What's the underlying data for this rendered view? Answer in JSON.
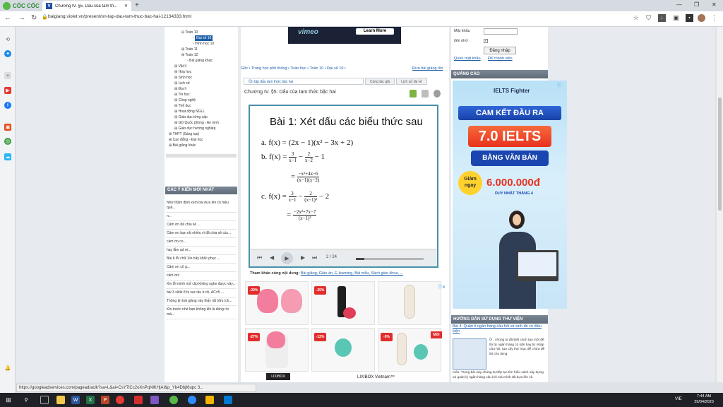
{
  "browser": {
    "brand": "CỐC CỐC",
    "tab_title": "Chương IV. §5. Dấu của tam th...",
    "tab_favicon": "V",
    "url": "baigiang.violet.vn/present/on-tap-dau-tam-thuc-bac-hai-12134333.html"
  },
  "tree": {
    "items": [
      "Toán 10",
      "Đại số 10",
      "Hình học 10",
      "Toán 11",
      "Toán 12",
      "Bài giảng khác",
      "Vật lí",
      "Hóa học",
      "Sinh học",
      "Lịch sử",
      "Địa lí",
      "Tin học",
      "Công nghệ",
      "Thể dục",
      "Hoạt động NGLL",
      "Giáo dục từng cấp",
      "GD Quốc phòng - An ninh",
      "Giáo dục hướng nghiệp",
      "THPT (Sáng tạo)",
      "Cao đẳng - Đại học",
      "Bài giảng khác"
    ]
  },
  "comments": {
    "heading": "CÁC Ý KIẾN MỚI NHẤT",
    "items": [
      "Nhờ thầm định xem bài dưa lên có hiệu quả...",
      "n...",
      "Cảm ơn đã chia sẻ ...",
      "Cảm ơn bạn rất nhiều vì đã chia sẻ các...",
      "cảm ơn co...",
      "hay lắm ạd ơi...",
      "Bài b lỗi chữ Xin hãy khắc phục ...",
      "Cảm ơn cô g...",
      "cảm ơn!",
      "Xin lỗi mình mở clip không nghe được vậy...",
      "bài 3 slide 8 bị sai câu b rồi, AC=5 ...",
      "Thông tin bài giảng này thấy rất hữu ích...",
      "Khi trước nhé bạn không khi là đúng rồi mà..."
    ]
  },
  "ad_top": {
    "brand": "vimeo",
    "button": "Learn More"
  },
  "breadcrumb": "Gốc • Trung học phổ thông • Toán học • Toán 10 • Đại số 10 •",
  "download_link": "Đưa bài giảng lên",
  "tabs": [
    "Ôn tập dấu tam thức bậc hai",
    "Cùng tác giả",
    "Lịch sử tải về"
  ],
  "doc_title": "Chương IV. §5. Dấu của tam thức bậc hai",
  "slide": {
    "title": "Bài 1: Xét dấu các biểu thức sau",
    "a": "a. f(x) = (2x − 1)(x² − 3x + 2)",
    "b_label": "b. f(x) =",
    "c_label": "c. f(x) =",
    "fa_num": "3",
    "fa_den": "x−1",
    "fb_num": "2",
    "fb_den": "x−2",
    "b_tail": "− 1",
    "b_res_num": "−x²+4x−6",
    "b_res_den": "(x−1)(x−2)",
    "fc_num": "3",
    "fc_den": "x−1",
    "fd_num": "2",
    "fd_den": "(x−1)²",
    "c_tail": "− 2",
    "c_res_num": "−2x²+7x−7",
    "c_res_den": "(x−1)²",
    "eq": "=",
    "minus": "−",
    "page": "2 / 24"
  },
  "reference": {
    "label": "Tham khảo cùng nội dung:",
    "links": "Bài giảng, Giáo án, E-learning, Bài mẫu, Sách giáo khoa, ..."
  },
  "products": {
    "discounts": [
      "-29%",
      "-25%",
      "-27%",
      "-12%",
      "-9%"
    ],
    "sale_badge": "Mới",
    "brand1": "LIXIBOX",
    "brand2": "LIXIBOX Vietnam™"
  },
  "login": {
    "password_label": "Mật khẩu",
    "remember_label": "Ghi nhớ",
    "login_button": "Đăng nhập",
    "forgot": "Quên mật khẩu",
    "register": "ĐK thành viên"
  },
  "ads_heading": "QUẢNG CÁO",
  "ielts": {
    "logo": "IELTS Fighter",
    "ribbon": "CAM KẾT ĐẦU RA",
    "big": "7.0 IELTS",
    "bvb": "BẰNG VĂN BẢN",
    "giam": "Giảm ngay",
    "money": "6.000.000đ",
    "duy": "DUY NHẤT THÁNG 4"
  },
  "guide": {
    "heading": "HƯỚNG DẪN SỬ DỤNG THƯ VIỆN",
    "title": "Bài 4: Quản lí ngân hàng câu hỏi và sinh đề có điều kiện",
    "text": "Ở , chúng ta đã biết cách tạo một đề thi từ ngân hàng có sẵn hay từ nhập câu hỏi, tạo cây thư mục để chứa đề thi cho từng",
    "text2": "môn. Trong bài này chúng ta tiếp tục tìm hiểu cách xây dựng và quản lý ngân hàng câu hỏi mà mình đã dựa lên và"
  },
  "status_url": "https://googleadservices.com/pagead/aclk?sa=L&ai=CsY7iCc2oXnPqNlKHjAI&p_Yb4DbjI6upc 3...",
  "taskbar": {
    "lang": "VIE",
    "time": "7:44 AM",
    "date": "29/04/2020"
  }
}
